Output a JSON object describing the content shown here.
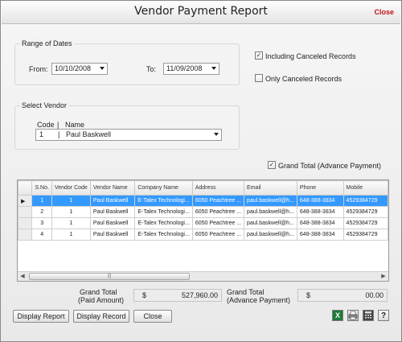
{
  "window": {
    "title": "Vendor Payment Report",
    "close_label": "Close"
  },
  "dates": {
    "group_label": "Range of Dates",
    "from_label": "From:",
    "from_value": "10/10/2008",
    "to_label": "To:",
    "to_value": "11/09/2008"
  },
  "options": {
    "including_canceled_label": "Including Canceled Records",
    "including_canceled_checked": true,
    "only_canceled_label": "Only Canceled Records",
    "only_canceled_checked": false
  },
  "vendor": {
    "group_label": "Select Vendor",
    "header_code": "Code",
    "header_sep": "|",
    "header_name": "Name",
    "selected_code": "1",
    "selected_sep": "|",
    "selected_name": "Paul Baskwell"
  },
  "grand_total_advance_checkbox": {
    "label": "Grand Total (Advance Payment)",
    "checked": true
  },
  "grid": {
    "columns": [
      "S.No.",
      "Vendor Code",
      "Vendor Name",
      "Company Name",
      "Address",
      "Email",
      "Phone",
      "Mobile"
    ],
    "rows": [
      {
        "sno": "1",
        "code": "1",
        "vendor": "Paul Baskwell",
        "company": "E-Talex Technologi...",
        "address": "6050 Peachtree ...",
        "email": "paul.baskwell@h...",
        "phone": "648-388-3834",
        "mobile": "4529384729"
      },
      {
        "sno": "2",
        "code": "1",
        "vendor": "Paul Baskwell",
        "company": "E-Talex Technologi...",
        "address": "6050 Peachtree ...",
        "email": "paul.baskwell@h...",
        "phone": "648-388-3834",
        "mobile": "4529384729"
      },
      {
        "sno": "3",
        "code": "1",
        "vendor": "Paul Baskwell",
        "company": "E-Talex Technologi...",
        "address": "6050 Peachtree ...",
        "email": "paul.baskwell@h...",
        "phone": "648-388-3834",
        "mobile": "4529384729"
      },
      {
        "sno": "4",
        "code": "1",
        "vendor": "Paul Baskwell",
        "company": "E-Talex Technologi...",
        "address": "6050 Peachtree ...",
        "email": "paul.baskwell@h...",
        "phone": "648-388-3834",
        "mobile": "4529384729"
      }
    ],
    "selected_row": 0,
    "selection_marker": "▶",
    "scroll_left": "◀",
    "scroll_right": "▶",
    "scroll_thumb_grip": "|||"
  },
  "totals": {
    "paid_label_line1": "Grand Total",
    "paid_label_line2": "(Paid Amount)",
    "paid_currency": "$",
    "paid_value": "527,960.00",
    "advance_label_line1": "Grand Total",
    "advance_label_line2": "(Advance Payment)",
    "advance_currency": "$",
    "advance_value": "00.00"
  },
  "buttons": {
    "display_report": "Display Report",
    "display_record": "Display Record",
    "close": "Close"
  },
  "tools": {
    "excel_glyph": "X",
    "help_glyph": "?"
  },
  "colors": {
    "close_link": "#c0121a",
    "selection": "#3399ff",
    "excel": "#1d7a3a"
  }
}
